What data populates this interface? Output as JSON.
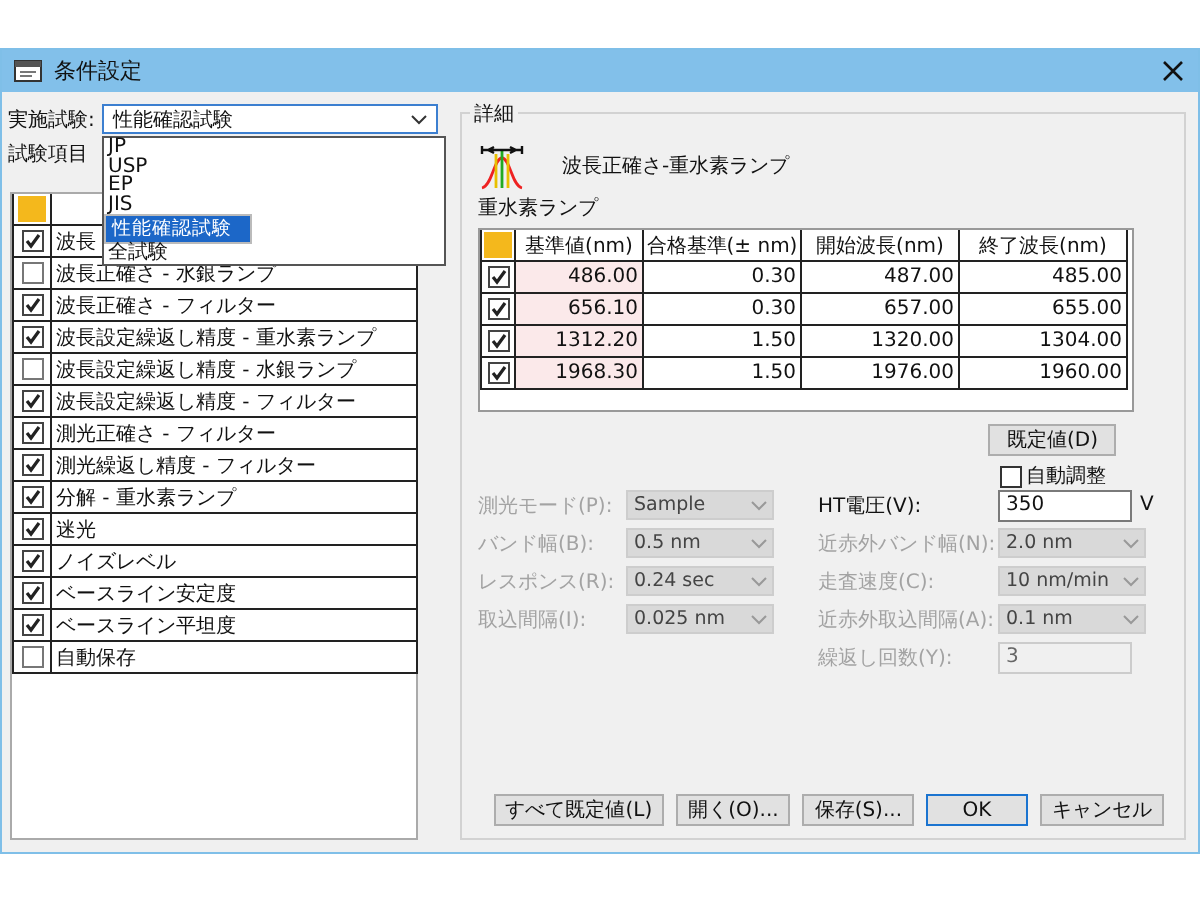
{
  "window": {
    "title": "条件設定"
  },
  "test_mode": {
    "label": "実施試験:",
    "value": "性能確認試験",
    "options": [
      {
        "label": "JP",
        "selected": false
      },
      {
        "label": "USP",
        "selected": false
      },
      {
        "label": "EP",
        "selected": false
      },
      {
        "label": "JIS",
        "selected": false
      },
      {
        "label": "性能確認試験",
        "selected": true
      },
      {
        "label": "全試験",
        "selected": false
      }
    ]
  },
  "test_items": {
    "label": "試験項目",
    "items": [
      {
        "name": "波長",
        "checked": true
      },
      {
        "name": "波長正確さ - 水銀ランプ",
        "checked": false
      },
      {
        "name": "波長正確さ - フィルター",
        "checked": true
      },
      {
        "name": "波長設定繰返し精度 - 重水素ランプ",
        "checked": true
      },
      {
        "name": "波長設定繰返し精度 - 水銀ランプ",
        "checked": false
      },
      {
        "name": "波長設定繰返し精度 - フィルター",
        "checked": true
      },
      {
        "name": "測光正確さ - フィルター",
        "checked": true
      },
      {
        "name": "測光繰返し精度 - フィルター",
        "checked": true
      },
      {
        "name": "分解 - 重水素ランプ",
        "checked": true
      },
      {
        "name": "迷光",
        "checked": true
      },
      {
        "name": "ノイズレベル",
        "checked": true
      },
      {
        "name": "ベースライン安定度",
        "checked": true
      },
      {
        "name": "ベースライン平坦度",
        "checked": true
      },
      {
        "name": "自動保存",
        "checked": false
      }
    ]
  },
  "details": {
    "label": "詳細",
    "test_name": "波長正確さ-重水素ランプ",
    "lamp": "重水素ランプ",
    "table": {
      "columns": [
        "基準値(nm)",
        "合格基準(± nm)",
        "開始波長(nm)",
        "終了波長(nm)"
      ],
      "rows": [
        {
          "checked": true,
          "cells": [
            "486.00",
            "0.30",
            "487.00",
            "485.00"
          ]
        },
        {
          "checked": true,
          "cells": [
            "656.10",
            "0.30",
            "657.00",
            "655.00"
          ]
        },
        {
          "checked": true,
          "cells": [
            "1312.20",
            "1.50",
            "1320.00",
            "1304.00"
          ]
        },
        {
          "checked": true,
          "cells": [
            "1968.30",
            "1.50",
            "1976.00",
            "1960.00"
          ]
        }
      ]
    },
    "default_button": "既定値(D)",
    "auto_adjust": {
      "label": "自動調整",
      "checked": false
    },
    "fields_left": [
      {
        "label": "測光モード(P):",
        "value": "Sample",
        "kind": "select",
        "disabled": true
      },
      {
        "label": "バンド幅(B):",
        "value": "0.5 nm",
        "kind": "select",
        "disabled": true
      },
      {
        "label": "レスポンス(R):",
        "value": "0.24 sec",
        "kind": "select",
        "disabled": true
      },
      {
        "label": "取込間隔(I):",
        "value": "0.025 nm",
        "kind": "select",
        "disabled": true
      }
    ],
    "fields_right": [
      {
        "label": "HT電圧(V):",
        "value": "350",
        "unit": "V",
        "kind": "input",
        "disabled": false
      },
      {
        "label": "近赤外バンド幅(N):",
        "value": "2.0 nm",
        "kind": "select",
        "disabled": true
      },
      {
        "label": "走査速度(C):",
        "value": "10 nm/min",
        "kind": "select",
        "disabled": true
      },
      {
        "label": "近赤外取込間隔(A):",
        "value": "0.1 nm",
        "kind": "select",
        "disabled": true
      },
      {
        "label": "繰返し回数(Y):",
        "value": "3",
        "kind": "input",
        "disabled": true
      }
    ]
  },
  "buttons": [
    {
      "label": "すべて既定値(L)",
      "default": false
    },
    {
      "label": "開く(O)...",
      "default": false
    },
    {
      "label": "保存(S)...",
      "default": false
    },
    {
      "label": "OK",
      "default": true
    },
    {
      "label": "キャンセル",
      "default": false
    }
  ]
}
